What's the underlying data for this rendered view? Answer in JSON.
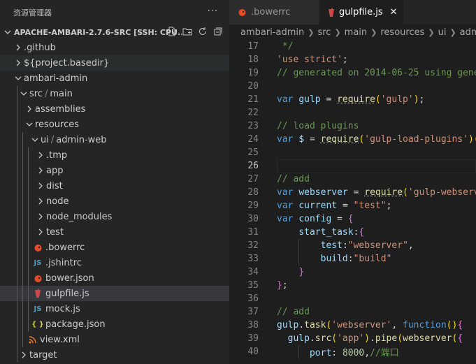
{
  "sidebar": {
    "title": "资源管理器",
    "more": "···",
    "section_title": "APACHE-AMBARI-2.7.6-SRC [SSH: CPU...",
    "items": [
      {
        "label": ".github"
      },
      {
        "label": "${project.basedir}"
      },
      {
        "label": "ambari-admin"
      },
      {
        "label_a": "src",
        "label_b": "main"
      },
      {
        "label": "assemblies"
      },
      {
        "label": "resources"
      },
      {
        "label_a": "ui",
        "label_b": "admin-web"
      },
      {
        "label": ".tmp"
      },
      {
        "label": "app"
      },
      {
        "label": "dist"
      },
      {
        "label": "node"
      },
      {
        "label": "node_modules"
      },
      {
        "label": "test"
      },
      {
        "label": ".bowerrc"
      },
      {
        "label": ".jshintrc",
        "icon": "JS"
      },
      {
        "label": "bower.json"
      },
      {
        "label": "gulpfile.js"
      },
      {
        "label": "mock.js",
        "icon": "JS"
      },
      {
        "label": "package.json",
        "icon": "{ }"
      },
      {
        "label": "view.xml"
      },
      {
        "label": "target"
      }
    ]
  },
  "tabs": [
    {
      "label": ".bowerrc"
    },
    {
      "label": "gulpfile.js",
      "close": "✕"
    }
  ],
  "breadcrumb": [
    "ambari-admin",
    "src",
    "main",
    "resources",
    "ui",
    "admin-web"
  ],
  "code": {
    "lines": [
      {
        "n": "17",
        "text": " */"
      },
      {
        "n": "18",
        "text": "'use strict';"
      },
      {
        "n": "19",
        "text": "// generated on 2014-06-25 using gene"
      },
      {
        "n": "20",
        "text": ""
      },
      {
        "n": "21",
        "text": "var gulp = require('gulp');"
      },
      {
        "n": "22",
        "text": ""
      },
      {
        "n": "23",
        "text": "// load plugins"
      },
      {
        "n": "24",
        "text": "var $ = require('gulp-load-plugins')("
      },
      {
        "n": "25",
        "text": ""
      },
      {
        "n": "26",
        "text": ""
      },
      {
        "n": "27",
        "text": "// add"
      },
      {
        "n": "28",
        "text": "var webserver = require('gulp-webserv"
      },
      {
        "n": "29",
        "text": "var current = \"test\";"
      },
      {
        "n": "30",
        "text": "var config = {"
      },
      {
        "n": "31",
        "text": "    start_task:{"
      },
      {
        "n": "32",
        "text": "        test:\"webserver\","
      },
      {
        "n": "33",
        "text": "        build:\"build\""
      },
      {
        "n": "34",
        "text": "    }"
      },
      {
        "n": "35",
        "text": "};"
      },
      {
        "n": "36",
        "text": ""
      },
      {
        "n": "37",
        "text": "// add"
      },
      {
        "n": "38",
        "text": "gulp.task('webserver', function(){"
      },
      {
        "n": "39",
        "text": "  gulp.src('app').pipe(webserver({"
      },
      {
        "n": "40",
        "text": "      port: 8000,//端口"
      }
    ]
  },
  "colors": {
    "bower_icon": "#e44d26",
    "gulp_icon": "#cf4647",
    "js_icon": "#519aba",
    "json_icon": "#cbcb41",
    "xml_icon": "#e37933"
  }
}
